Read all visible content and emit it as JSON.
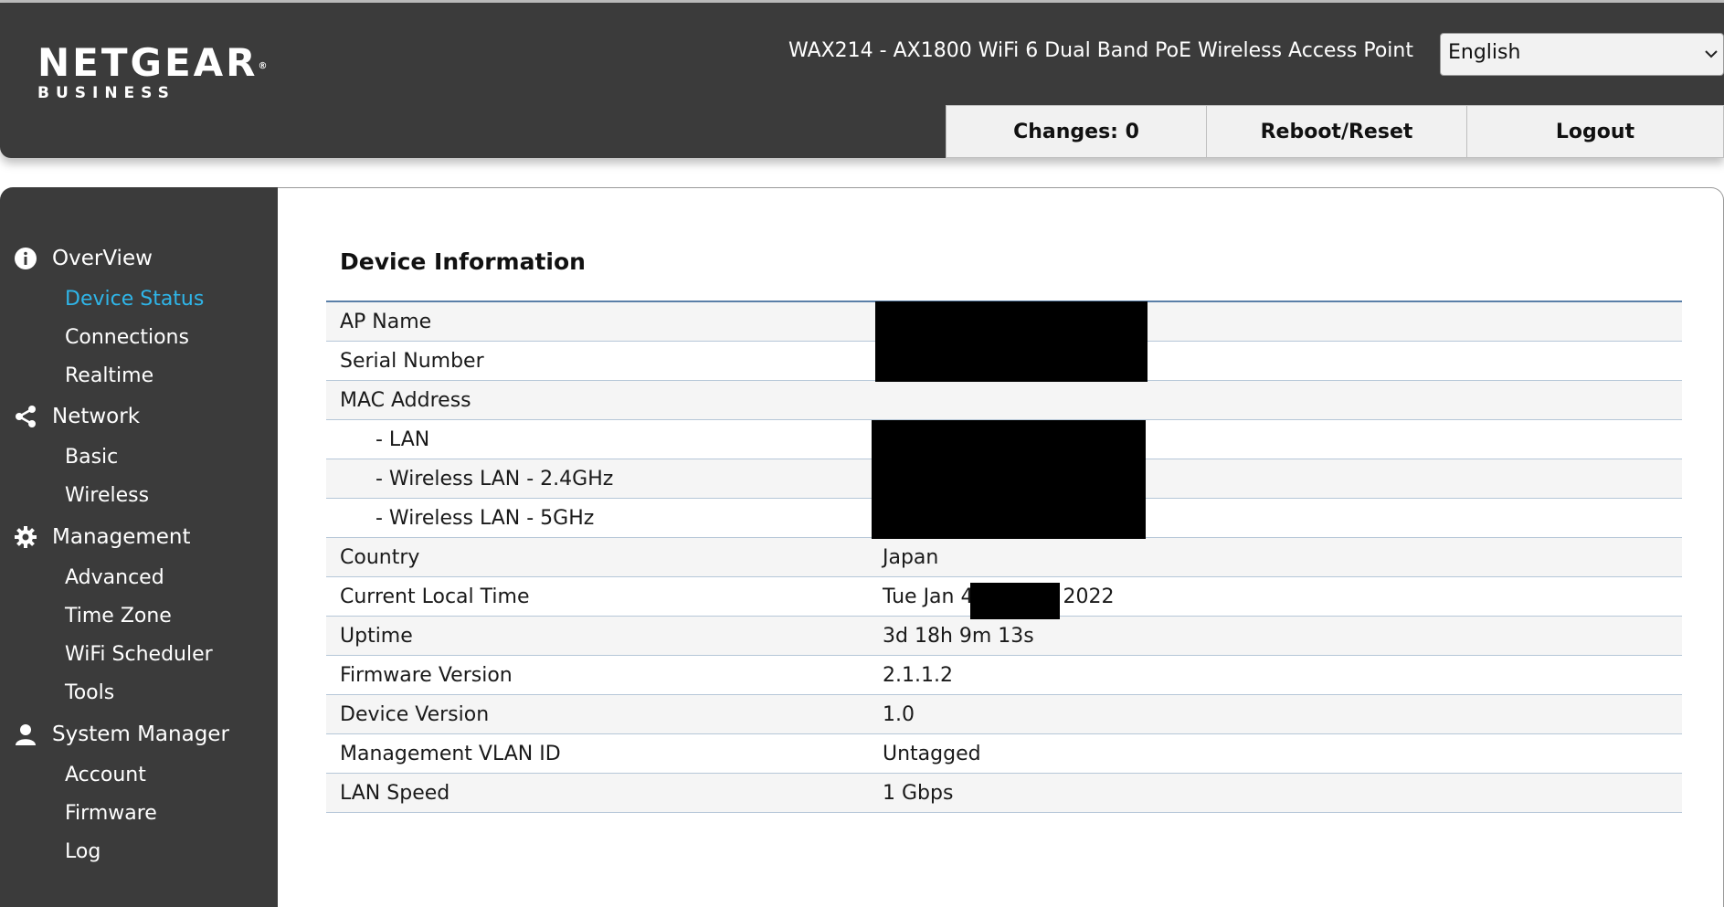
{
  "header": {
    "logo_main": "NETGEAR",
    "logo_mark": "®",
    "logo_sub": "BUSINESS",
    "product_title": "WAX214 - AX1800 WiFi 6 Dual Band PoE Wireless Access Point",
    "language": "English",
    "buttons": {
      "changes": "Changes: 0",
      "reboot": "Reboot/Reset",
      "logout": "Logout"
    }
  },
  "sidebar": {
    "overview": {
      "label": "OverView",
      "icon": "info-icon",
      "items": [
        "Device Status",
        "Connections",
        "Realtime"
      ]
    },
    "network": {
      "label": "Network",
      "icon": "share-icon",
      "items": [
        "Basic",
        "Wireless"
      ]
    },
    "management": {
      "label": "Management",
      "icon": "gear-icon",
      "items": [
        "Advanced",
        "Time Zone",
        "WiFi Scheduler",
        "Tools"
      ]
    },
    "system": {
      "label": "System Manager",
      "icon": "user-icon",
      "items": [
        "Account",
        "Firmware",
        "Log"
      ]
    },
    "active_item": "Device Status",
    "active_color": "#2fb5e8"
  },
  "main": {
    "title": "Device Information",
    "rows": [
      {
        "label": "AP Name",
        "value": ""
      },
      {
        "label": "Serial Number",
        "value": ""
      },
      {
        "label": "MAC Address",
        "value": ""
      },
      {
        "label": "- LAN",
        "value": ""
      },
      {
        "label": "- Wireless LAN - 2.4GHz",
        "value": ""
      },
      {
        "label": "- Wireless LAN - 5GHz",
        "value": ""
      },
      {
        "label": "Country",
        "value": "Japan"
      },
      {
        "label": "Current Local Time",
        "value_prefix": "Tue Jan 4",
        "value_suffix": "2022"
      },
      {
        "label": "Uptime",
        "value": "3d 18h 9m 13s"
      },
      {
        "label": "Firmware Version",
        "value": "2.1.1.2"
      },
      {
        "label": "Device Version",
        "value": "1.0"
      },
      {
        "label": "Management VLAN ID",
        "value": "Untagged"
      },
      {
        "label": "LAN Speed",
        "value": "1 Gbps"
      }
    ]
  }
}
